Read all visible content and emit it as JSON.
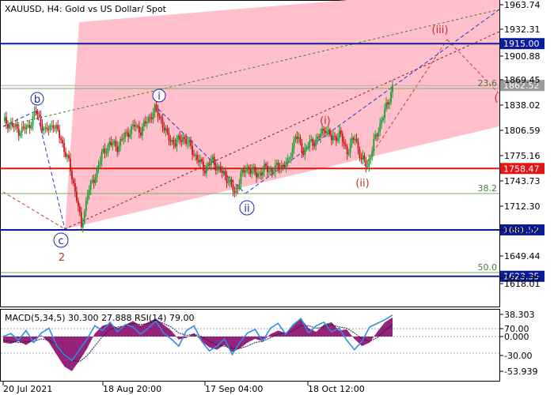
{
  "header": {
    "symbol_line": "XAUUSD, H4:  Gold vs US Dollar/ Spot"
  },
  "indicator_header": "MACD(5,34,5) 30.300 27.888 RSI(14) 79.00",
  "colors": {
    "level_blue": "#0a1c9c",
    "level_red": "#e01515",
    "fib_green": "#7cae5e",
    "channel_fill": "#ffc0cb",
    "candle_up": "#16a02d",
    "candle_down": "#c8161d",
    "macd_fill": "#8a0b6a",
    "rsi_line": "#2f8de6",
    "signal_line": "#1a1a3a"
  },
  "chart_data": [
    {
      "type": "candlestick",
      "title": "XAUUSD, H4:  Gold vs US Dollar/ Spot",
      "ylim": [
        1595,
        1970
      ],
      "y_ticks": [
        "1963.74",
        "1932.31",
        "1900.88",
        "1869.45",
        "1838.02",
        "1806.59",
        "1775.16",
        "1743.73",
        "1712.30",
        "1681.52",
        "1649.44",
        "1623.35",
        "1618.01"
      ],
      "x_ticks": [
        "20 Jul 2021",
        "18 Aug 20:00",
        "17 Sep 04:00",
        "18 Oct 12:00"
      ],
      "price_path": [
        [
          0,
          1818
        ],
        [
          6,
          1812
        ],
        [
          10,
          1806
        ],
        [
          16,
          1810
        ],
        [
          21,
          1830
        ],
        [
          27,
          1804
        ],
        [
          32,
          1815
        ],
        [
          37,
          1795
        ],
        [
          42,
          1765
        ],
        [
          47,
          1722
        ],
        [
          50,
          1684
        ],
        [
          54,
          1728
        ],
        [
          58,
          1745
        ],
        [
          63,
          1775
        ],
        [
          68,
          1790
        ],
        [
          73,
          1786
        ],
        [
          78,
          1800
        ],
        [
          84,
          1812
        ],
        [
          88,
          1806
        ],
        [
          92,
          1818
        ],
        [
          97,
          1832
        ],
        [
          101,
          1820
        ],
        [
          105,
          1798
        ],
        [
          110,
          1790
        ],
        [
          115,
          1798
        ],
        [
          120,
          1785
        ],
        [
          124,
          1770
        ],
        [
          129,
          1758
        ],
        [
          134,
          1768
        ],
        [
          139,
          1755
        ],
        [
          144,
          1745
        ],
        [
          148,
          1726
        ],
        [
          152,
          1750
        ],
        [
          157,
          1760
        ],
        [
          162,
          1750
        ],
        [
          167,
          1758
        ],
        [
          172,
          1756
        ],
        [
          177,
          1762
        ],
        [
          182,
          1764
        ],
        [
          187,
          1800
        ],
        [
          192,
          1780
        ],
        [
          196,
          1790
        ],
        [
          201,
          1795
        ],
        [
          206,
          1810
        ],
        [
          210,
          1795
        ],
        [
          215,
          1802
        ],
        [
          220,
          1780
        ],
        [
          225,
          1798
        ],
        [
          229,
          1770
        ],
        [
          233,
          1762
        ],
        [
          237,
          1790
        ],
        [
          242,
          1820
        ],
        [
          246,
          1840
        ],
        [
          249,
          1862
        ]
      ],
      "levels": [
        {
          "label": "1915.00",
          "price": 1915,
          "color": "blue"
        },
        {
          "label": "1862.52",
          "price": 1862.52,
          "color": "grey"
        },
        {
          "label": "1758.47",
          "price": 1758.47,
          "color": "red"
        },
        {
          "label": "1681.52",
          "price": 1681.52,
          "color": "blue"
        },
        {
          "label": "1623.35",
          "price": 1623.35,
          "color": "blue"
        }
      ],
      "fib_levels": [
        {
          "label": "23.6",
          "price": 1864
        },
        {
          "label": "38.2",
          "price": 1730
        },
        {
          "label": "50.0",
          "price": 1625
        }
      ],
      "wave_labels": [
        {
          "text": "b",
          "style": "blue-circle"
        },
        {
          "text": "i",
          "style": "blue-circle"
        },
        {
          "text": "ii",
          "style": "blue-circle"
        },
        {
          "text": "c",
          "style": "blue-circle"
        },
        {
          "text": "2",
          "style": "red"
        },
        {
          "text": "(i)",
          "style": "red"
        },
        {
          "text": "(ii)",
          "style": "red"
        },
        {
          "text": "(iii)",
          "style": "red"
        },
        {
          "text": "(",
          "style": "red"
        }
      ]
    },
    {
      "type": "area",
      "title": "MACD(5,34,5) 30.300 27.888 RSI(14) 79.00",
      "ylim": [
        -60,
        45
      ],
      "y_ticks": [
        "38.303",
        "70.00",
        "0.000",
        "-30.00",
        "-53.939"
      ],
      "macd": [
        -10,
        -12,
        -8,
        -14,
        -6,
        2,
        -10,
        -30,
        -50,
        -58,
        -40,
        -20,
        5,
        18,
        22,
        14,
        20,
        26,
        18,
        24,
        30,
        20,
        10,
        -5,
        -2,
        6,
        -8,
        -18,
        -22,
        -14,
        -26,
        -20,
        -10,
        -4,
        -8,
        4,
        10,
        6,
        18,
        30,
        14,
        8,
        20,
        24,
        10,
        12,
        -4,
        -16,
        -10,
        8,
        24,
        32
      ],
      "rsi": [
        0,
        5,
        -6,
        10,
        -10,
        6,
        14,
        -15,
        -30,
        -40,
        -22,
        -4,
        18,
        10,
        24,
        8,
        20,
        16,
        4,
        14,
        26,
        6,
        -4,
        -16,
        10,
        18,
        -8,
        -24,
        -16,
        -4,
        -30,
        -10,
        6,
        12,
        -8,
        14,
        22,
        4,
        20,
        30,
        6,
        18,
        24,
        8,
        14,
        -6,
        -22,
        -8,
        16,
        22,
        28,
        36
      ],
      "signal": [
        -6,
        -8,
        -10,
        -9,
        -8,
        -4,
        -6,
        -14,
        -28,
        -40,
        -42,
        -32,
        -16,
        0,
        12,
        16,
        18,
        22,
        20,
        22,
        26,
        22,
        16,
        6,
        2,
        4,
        0,
        -8,
        -14,
        -16,
        -20,
        -20,
        -16,
        -10,
        -8,
        -2,
        4,
        6,
        10,
        18,
        18,
        14,
        16,
        20,
        16,
        14,
        6,
        -4,
        -8,
        -2,
        10,
        20
      ]
    }
  ]
}
